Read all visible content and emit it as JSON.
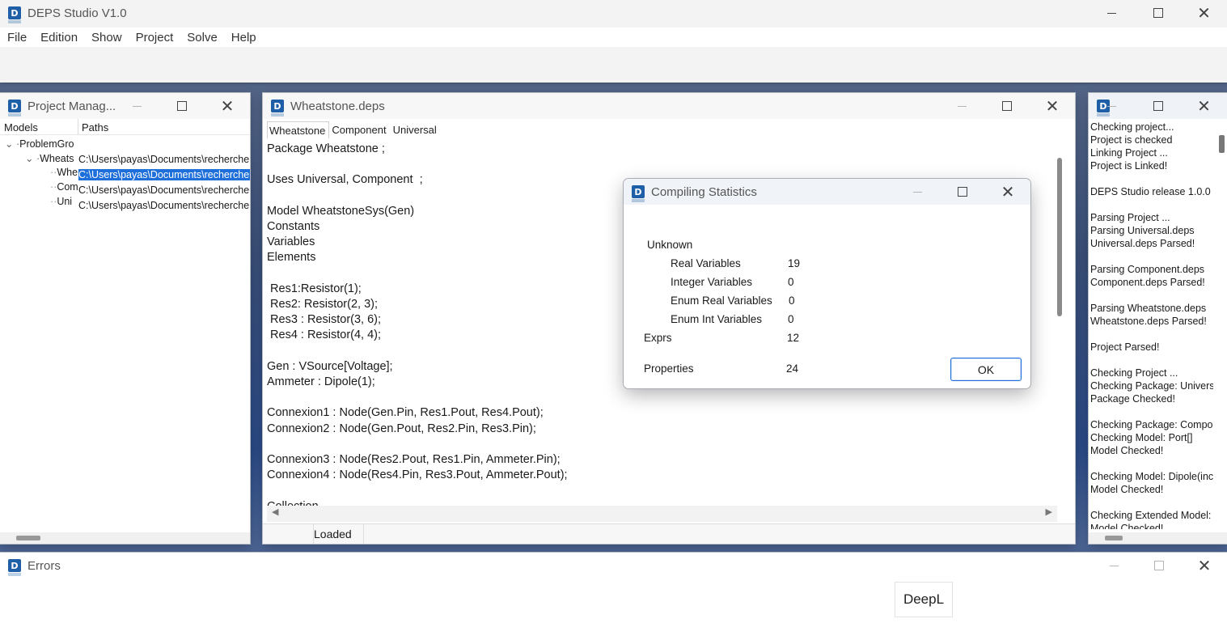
{
  "main": {
    "title": "DEPS Studio V1.0",
    "menu": [
      "File",
      "Edition",
      "Show",
      "Project",
      "Solve",
      "Help"
    ]
  },
  "project_manager": {
    "title": "Project Manag...",
    "columns": [
      "Models",
      "Paths"
    ],
    "tree": [
      "ProblemGro",
      "Wheats",
      "Whe",
      "Com",
      "Uni"
    ],
    "paths": [
      "C:\\Users\\payas\\Documents\\recherche",
      "C:\\Users\\payas\\Documents\\recherche",
      "C:\\Users\\payas\\Documents\\recherche",
      "C:\\Users\\payas\\Documents\\recherche"
    ]
  },
  "editor": {
    "title": "Wheatstone.deps",
    "tabs": [
      "Wheatstone",
      "Component",
      "Universal"
    ],
    "code": "Package Wheatstone ;\n\nUses Universal, Component  ;\n\nModel WheatstoneSys(Gen)\nConstants\nVariables\nElements\n\n Res1:Resistor(1);\n Res2: Resistor(2, 3);\n Res3 : Resistor(3, 6);\n Res4 : Resistor(4, 4);\n\nGen : VSource[Voltage];\nAmmeter : Dipole(1);\n\nConnexion1 : Node(Gen.Pin, Res1.Pout, Res4.Pout);\nConnexion2 : Node(Gen.Pout, Res2.Pin, Res3.Pin);\n\nConnexion3 : Node(Res2.Pout, Res1.Pin, Ammeter.Pin);\nConnexion4 : Node(Res4.Pin, Res3.Pout, Ammeter.Pout);\n\nCollection",
    "status": "Loaded"
  },
  "log": {
    "text": "Checking project...\nProject is checked\nLinking Project ...\nProject is Linked!\n\nDEPS Studio release 1.0.0\n\nParsing Project ...\nParsing Universal.deps\nUniversal.deps Parsed!\n\nParsing Component.deps\nComponent.deps Parsed!\n\nParsing Wheatstone.deps\nWheatstone.deps Parsed!\n\nProject Parsed!\n\nChecking Project ...\nChecking Package: Univers\nPackage Checked!\n\nChecking Package: Compo\nChecking Model: Port[]\nModel Checked!\n\nChecking Model: Dipole(inc\nModel Checked!\n\nChecking Extended Model:\nModel Checked!"
  },
  "errors": {
    "title": "Errors",
    "deepl": "DeepL"
  },
  "dialog": {
    "title": "Compiling Statistics",
    "unknown_label": "Unknown",
    "rows": [
      {
        "label": "Real Variables",
        "value": "19"
      },
      {
        "label": "Integer Variables",
        "value": "0"
      },
      {
        "label": "Enum Real Variables",
        "value": "0"
      },
      {
        "label": "Enum Int Variables",
        "value": "0"
      }
    ],
    "exprs_label": "Exprs",
    "exprs_value": "12",
    "properties_label": "Properties",
    "properties_value": "24",
    "ok_label": "OK"
  },
  "colors": {
    "accent": "#1e6fd9",
    "app_icon": "#1f5fa8"
  }
}
